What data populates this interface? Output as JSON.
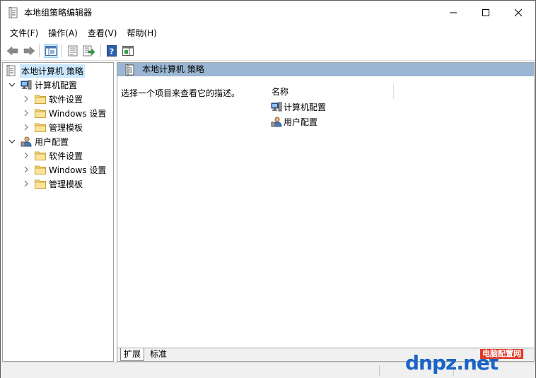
{
  "window": {
    "title": "本地组策略编辑器"
  },
  "menu": [
    "文件(F)",
    "操作(A)",
    "查看(V)",
    "帮助(H)"
  ],
  "tree": {
    "root": "本地计算机 策略",
    "computer_config": "计算机配置",
    "user_config": "用户配置",
    "software_settings": "软件设置",
    "windows_settings": "Windows 设置",
    "admin_templates": "管理模板"
  },
  "right": {
    "header_title": "本地计算机 策略",
    "description": "选择一个项目来查看它的描述。",
    "column_name": "名称",
    "items": [
      "计算机配置",
      "用户配置"
    ]
  },
  "tabs": {
    "extended": "扩展",
    "standard": "标准"
  },
  "watermark": {
    "brand_text": "dnpz",
    "domain_suffix": ".net",
    "tag": "电脑配置网"
  },
  "colors": {
    "header_bg": "#9bb6d3",
    "selection_bg": "#cce8ff",
    "folder_yellow": "#f2c94c",
    "watermark_blue": "#1a63c7",
    "watermark_red": "#e23a2a"
  }
}
